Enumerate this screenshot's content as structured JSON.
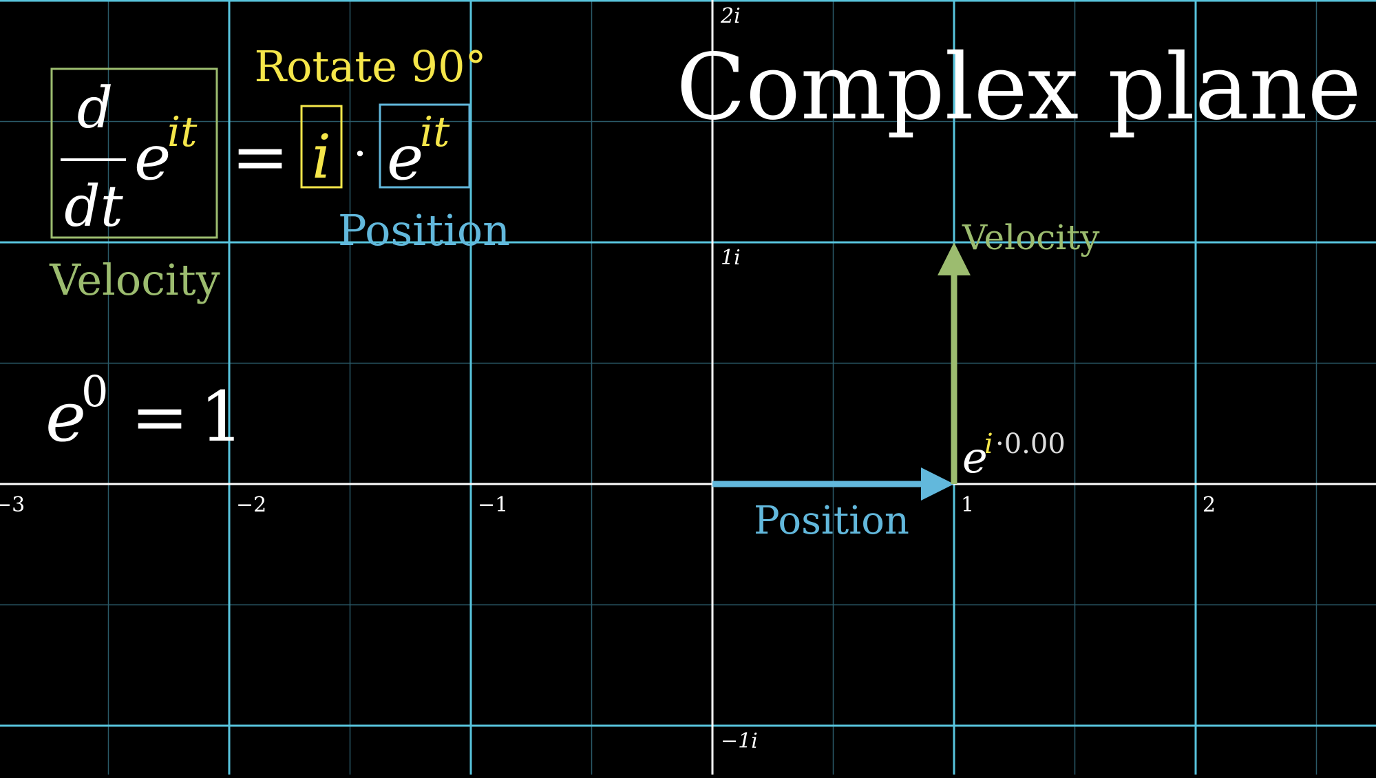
{
  "title": "Complex plane",
  "colors": {
    "background": "#000000",
    "grid_major": "#58c4dd",
    "grid_minor": "#2a5a68",
    "axis": "#ffffff",
    "velocity": "#9cbc6f",
    "position": "#62b8dc",
    "highlight_i": "#f5e64a",
    "text": "#ffffff"
  },
  "axes": {
    "x_ticks": [
      "−3",
      "−2",
      "−1",
      "1",
      "2"
    ],
    "y_ticks": [
      "2i",
      "1i",
      "−1i"
    ],
    "x_range": [
      -3,
      2.75
    ],
    "y_range": [
      -1.2,
      2
    ]
  },
  "equation": {
    "numerator": "d",
    "denominator": "dt",
    "base": "e",
    "exponent": "it",
    "equals": "=",
    "factor_i": "i",
    "dot": "·",
    "rhs_base": "e",
    "rhs_exponent": "it",
    "rotate_label": "Rotate 90°",
    "velocity_label": "Velocity",
    "position_label": "Position"
  },
  "initial": {
    "base": "e",
    "exponent": "0",
    "equals": "=",
    "value": "1"
  },
  "vectors": {
    "position": {
      "start": [
        0,
        0
      ],
      "end": [
        1,
        0
      ],
      "label": "Position"
    },
    "velocity": {
      "start": [
        1,
        0
      ],
      "end": [
        1,
        1
      ],
      "label": "Velocity"
    }
  },
  "point_label": {
    "base": "e",
    "exponent_i": "i",
    "exponent_rest": "·0.00"
  }
}
